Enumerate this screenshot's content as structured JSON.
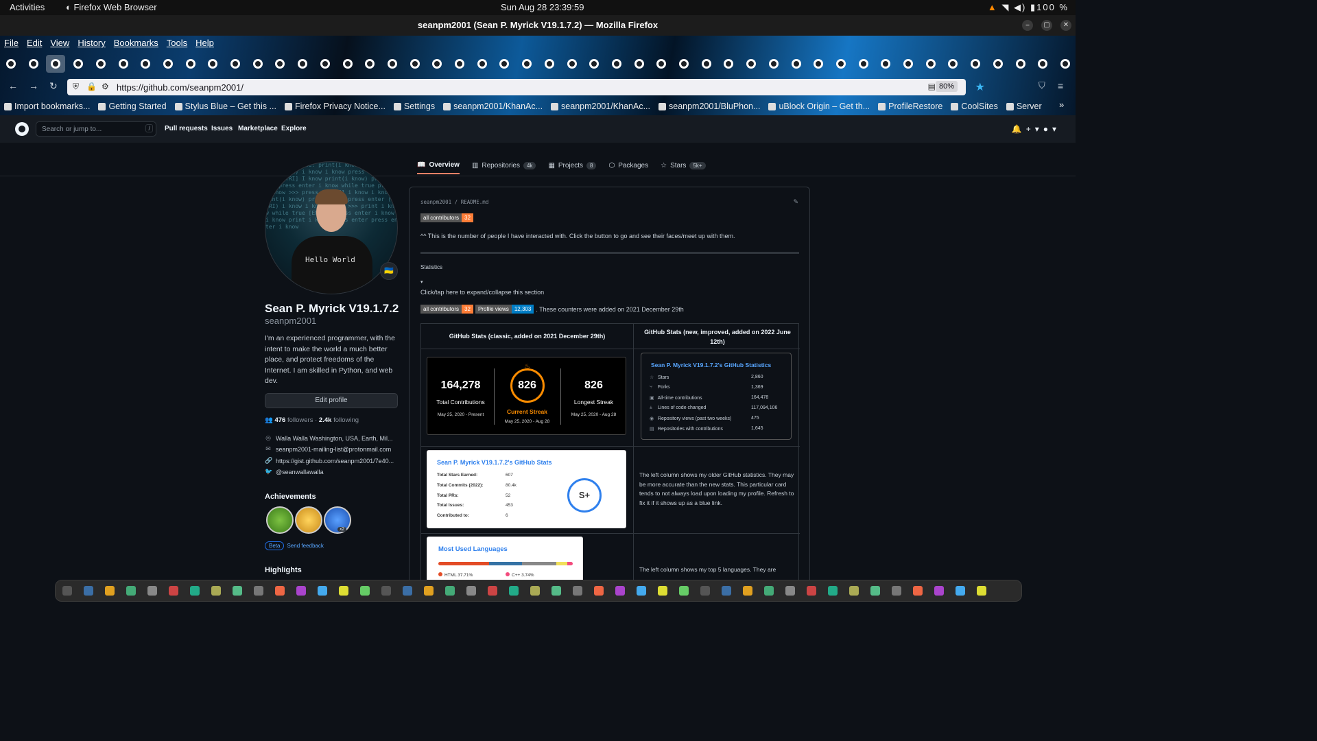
{
  "system_bar": {
    "activities": "Activities",
    "app": "Firefox Web Browser",
    "clock": "Sun Aug 28  23:39:59",
    "battery": "100 %"
  },
  "window": {
    "title": "seanpm2001 (Sean P. Myrick V19.1.7.2) — Mozilla Firefox"
  },
  "menu": [
    "File",
    "Edit",
    "View",
    "History",
    "Bookmarks",
    "Tools",
    "Help"
  ],
  "browser": {
    "url": "https://github.com/seanpm2001/",
    "zoom": "80%"
  },
  "bookmarks": [
    "Import bookmarks...",
    "Getting Started",
    "Stylus Blue – Get this ...",
    "Firefox Privacy Notice...",
    "Settings",
    "seanpm2001/KhanAc...",
    "seanpm2001/KhanAc...",
    "seanpm2001/BluPhon...",
    "uBlock Origin – Get th...",
    "ProfileRestore",
    "CoolSites",
    "Server"
  ],
  "github": {
    "search_placeholder": "Search or jump to...",
    "search_key": "/",
    "nav": [
      "Pull requests",
      "Issues",
      "Marketplace",
      "Explore"
    ]
  },
  "tabs": [
    {
      "label": "Overview",
      "count": ""
    },
    {
      "label": "Repositories",
      "count": "4k"
    },
    {
      "label": "Projects",
      "count": "8"
    },
    {
      "label": "Packages",
      "count": ""
    },
    {
      "label": "Stars",
      "count": "5k+"
    }
  ],
  "profile": {
    "name": "Sean P. Myrick V19.1.7.2",
    "login": "seanpm2001",
    "bio": "I'm an experienced programmer, with the intent to make the world a much better place, and protect freedoms of the Internet. I am skilled in Python, and web dev.",
    "edit": "Edit profile",
    "followers": "476",
    "followers_label": "followers",
    "following": "2.4k",
    "following_label": "following",
    "location": "Walla Walla Washington, USA, Earth, Mil...",
    "email": "seanpm2001-mailing-list@protonmail.com",
    "link": "https://gist.github.com/seanpm2001/7e40...",
    "twitter": "@seanwallawalla",
    "achievements_title": "Achievements",
    "ach_multiplier": "x2",
    "beta": "Beta",
    "feedback": "Send feedback",
    "highlights": "Highlights",
    "shirt_text": "Hello World"
  },
  "readme": {
    "path_user": "seanpm2001",
    "path_file": "README.md",
    "badge_contrib_label": "all contributors",
    "badge_contrib_value": "32",
    "contrib_note": "^^ This is the number of people I have interacted with. Click the button to go and see their faces/meet up with them.",
    "statistics": "Statistics",
    "toggle_marker": "▾",
    "expand_note": "Click/tap here to expand/collapse this section",
    "badge_views_label": "Profile views",
    "badge_views_value": "12,303",
    "counters_note": ". These counters were added on 2021 December 29th",
    "col1_header": "GitHub Stats (classic, added on 2021 December 29th)",
    "col2_header": "GitHub Stats (new, improved, added on 2022 June 12th)",
    "streak": {
      "total": "164,278",
      "total_label": "Total Contributions",
      "total_dates": "May 25, 2020 - Present",
      "current": "826",
      "current_label": "Current Streak",
      "current_dates": "May 25, 2020 - Aug 28",
      "longest": "826",
      "longest_label": "Longest Streak",
      "longest_dates": "May 25, 2020 - Aug 28"
    },
    "new_stats": {
      "title": "Sean P. Myrick V19.1.7.2's GitHub Statistics",
      "rows": [
        {
          "icon": "☆",
          "label": "Stars",
          "value": "2,860"
        },
        {
          "icon": "⑂",
          "label": "Forks",
          "value": "1,369"
        },
        {
          "icon": "▣",
          "label": "All-time contributions",
          "value": "164,478"
        },
        {
          "icon": "±",
          "label": "Lines of code changed",
          "value": "117,094,106"
        },
        {
          "icon": "◉",
          "label": "Repository views (past two weeks)",
          "value": "475"
        },
        {
          "icon": "▤",
          "label": "Repositories with contributions",
          "value": "1,645"
        }
      ]
    },
    "old_stats": {
      "title": "Sean P. Myrick V19.1.7.2's GitHub Stats",
      "rows": [
        {
          "label": "Total Stars Earned:",
          "value": "607"
        },
        {
          "label": "Total Commits (2022):",
          "value": "80.4k"
        },
        {
          "label": "Total PRs:",
          "value": "52"
        },
        {
          "label": "Total Issues:",
          "value": "453"
        },
        {
          "label": "Contributed to:",
          "value": "6"
        }
      ],
      "grade": "S+"
    },
    "old_desc": "The left column shows my older GitHub statistics. They may be more accurate than the new stats. This particular card tends to not always load upon loading my profile. Refresh to fix it if it shows up as a blue link.",
    "langs_desc": "The left column shows my top 5 languages. They are",
    "langs": {
      "title": "Most Used Languages",
      "items": [
        {
          "label": "HTML 37.71%",
          "pct": 37.71,
          "color": "#e34c26"
        },
        {
          "label": "C++ 3.74%",
          "pct": 3.74,
          "color": "#f34b7d"
        }
      ]
    }
  },
  "colors": {
    "github_bg": "#0d1117",
    "accent": "#58a6ff",
    "streak_ring": "#fb8c00",
    "tab_underline": "#f78166"
  }
}
